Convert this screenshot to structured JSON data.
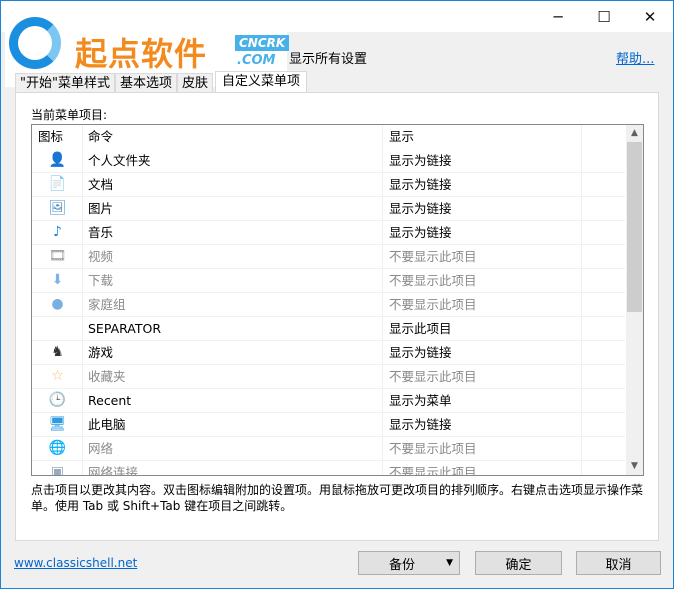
{
  "window": {
    "minimize": "─",
    "maximize": "☐",
    "close": "✕"
  },
  "logo": {
    "text": "起点软件",
    "badge": "CNCRK",
    ".com": ".COM"
  },
  "header": {
    "show_all": "显示所有设置",
    "help": "帮助..."
  },
  "tabs": [
    {
      "label": "\"开始\"菜单样式"
    },
    {
      "label": "基本选项"
    },
    {
      "label": "皮肤"
    },
    {
      "label": "自定义菜单项",
      "active": true
    }
  ],
  "list": {
    "label": "当前菜单项目:",
    "columns": [
      "图标",
      "命令",
      "显示"
    ],
    "rows": [
      {
        "icon": "user-folder-icon",
        "glyph": "👤",
        "command": "个人文件夹",
        "display": "显示为链接",
        "enabled": true
      },
      {
        "icon": "document-icon",
        "glyph": "📄",
        "command": "文档",
        "display": "显示为链接",
        "enabled": true
      },
      {
        "icon": "picture-icon",
        "glyph": "🖼",
        "command": "图片",
        "display": "显示为链接",
        "enabled": true
      },
      {
        "icon": "music-icon",
        "glyph": "♪",
        "command": "音乐",
        "display": "显示为链接",
        "enabled": true
      },
      {
        "icon": "video-icon",
        "glyph": "🎞",
        "command": "视频",
        "display": "不要显示此项目",
        "enabled": false
      },
      {
        "icon": "download-icon",
        "glyph": "⬇",
        "command": "下载",
        "display": "不要显示此项目",
        "enabled": false
      },
      {
        "icon": "homegroup-icon",
        "glyph": "●",
        "command": "家庭组",
        "display": "不要显示此项目",
        "enabled": false
      },
      {
        "icon": "",
        "glyph": "",
        "command": "SEPARATOR",
        "display": "显示此项目",
        "enabled": true
      },
      {
        "icon": "games-icon",
        "glyph": "♞",
        "command": "游戏",
        "display": "显示为链接",
        "enabled": true
      },
      {
        "icon": "favorites-icon",
        "glyph": "☆",
        "command": "收藏夹",
        "display": "不要显示此项目",
        "enabled": false
      },
      {
        "icon": "recent-icon",
        "glyph": "🕒",
        "command": "Recent",
        "display": "显示为菜单",
        "enabled": true
      },
      {
        "icon": "computer-icon",
        "glyph": "🖥",
        "command": "此电脑",
        "display": "显示为链接",
        "enabled": true
      },
      {
        "icon": "network-icon",
        "glyph": "🌐",
        "command": "网络",
        "display": "不要显示此项目",
        "enabled": false
      },
      {
        "icon": "network-connections-icon",
        "glyph": "▣",
        "command": "网络连接",
        "display": "不要显示此项目",
        "enabled": false
      }
    ]
  },
  "hint": "点击项目以更改其内容。双击图标编辑附加的设置项。用鼠标拖放可更改项目的排列顺序。右键点击选项显示操作菜单。使用 Tab 或 Shift+Tab 键在项目之间跳转。",
  "footer": {
    "link": "www.classicshell.net",
    "backup": "备份",
    "ok": "确定",
    "cancel": "取消"
  },
  "colors": {
    "accent": "#1883d7",
    "link": "#0066cc",
    "disabled_text": "#8a8a8a"
  }
}
